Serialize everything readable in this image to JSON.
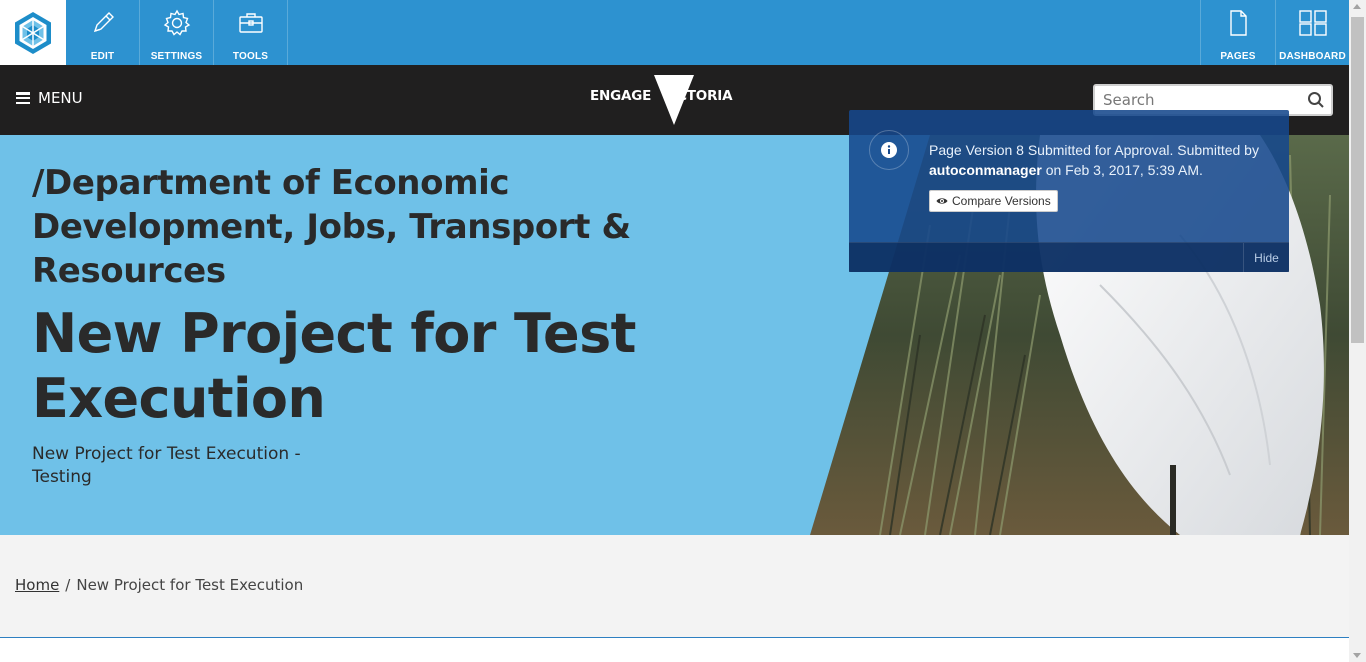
{
  "toolbar": {
    "logo": "cms-logo",
    "left_buttons": [
      {
        "label": "EDIT",
        "icon": "pencil-icon"
      },
      {
        "label": "SETTINGS",
        "icon": "gear-icon"
      },
      {
        "label": "TOOLS",
        "icon": "toolbox-icon"
      }
    ],
    "right_buttons": [
      {
        "label": "PAGES",
        "icon": "page-icon"
      },
      {
        "label": "DASHBOARD",
        "icon": "grid-icon"
      }
    ],
    "color": "#2d92d0"
  },
  "header": {
    "menu_label": "MENU",
    "brand_left": "ENGAGE",
    "brand_right": "VICTORIA",
    "search_placeholder": "Search"
  },
  "hero": {
    "department": "/Department of Economic Development, Jobs, Transport & Resources",
    "title": "New Project for Test Execution",
    "subtitle": "New Project for Test Execution - Testing",
    "background_color": "#6fc1e8"
  },
  "notice": {
    "text_before": "Page Version 8 Submitted for Approval. Submitted by ",
    "user": "autoconmanager",
    "text_after": " on Feb 3, 2017, 5:39 AM.",
    "compare_label": "Compare Versions",
    "hide_label": "Hide"
  },
  "breadcrumb": {
    "home": "Home",
    "separator": "/",
    "current": "New Project for Test Execution"
  }
}
